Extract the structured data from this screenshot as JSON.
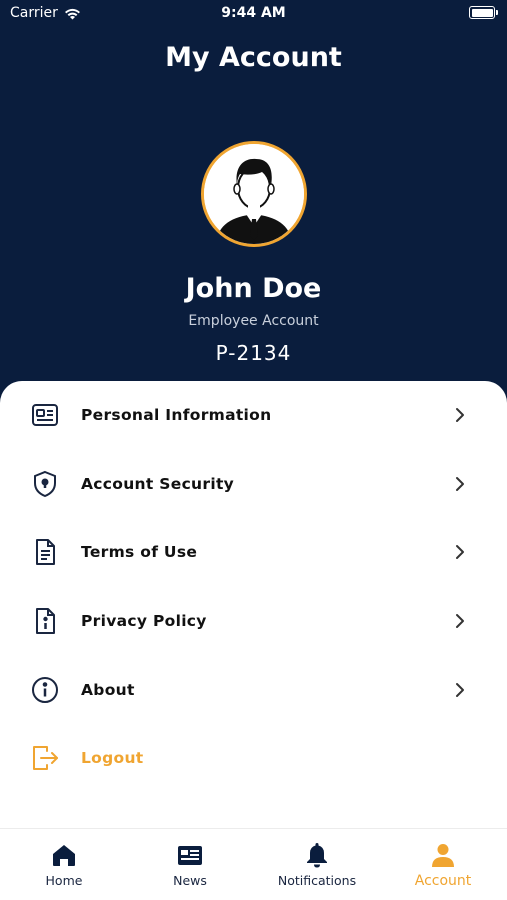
{
  "status_bar": {
    "carrier": "Carrier",
    "time": "9:44 AM",
    "icons": [
      "wifi-icon",
      "battery-icon"
    ]
  },
  "header": {
    "title": "My Account"
  },
  "profile": {
    "name": "John Doe",
    "account_type": "Employee Account",
    "employee_id": "P-2134",
    "avatar_icon": "user-avatar-icon"
  },
  "menu": {
    "items": [
      {
        "label": "Personal Information",
        "icon": "id-card-icon"
      },
      {
        "label": "Account Security",
        "icon": "shield-lock-icon"
      },
      {
        "label": "Terms of Use",
        "icon": "document-icon"
      },
      {
        "label": "Privacy Policy",
        "icon": "info-document-icon"
      },
      {
        "label": "About",
        "icon": "info-circle-icon"
      },
      {
        "label": "Logout",
        "icon": "logout-icon"
      }
    ]
  },
  "tabs": [
    {
      "label": "Home",
      "icon": "home-icon"
    },
    {
      "label": "News",
      "icon": "newspaper-icon"
    },
    {
      "label": "Notifications",
      "icon": "bell-icon"
    },
    {
      "label": "Account",
      "icon": "person-icon",
      "active": true
    }
  ],
  "colors": {
    "header_bg": "#0a1d3d",
    "accent": "#f0a531",
    "text_dark": "#111111",
    "icon_navy": "#1a2640"
  }
}
